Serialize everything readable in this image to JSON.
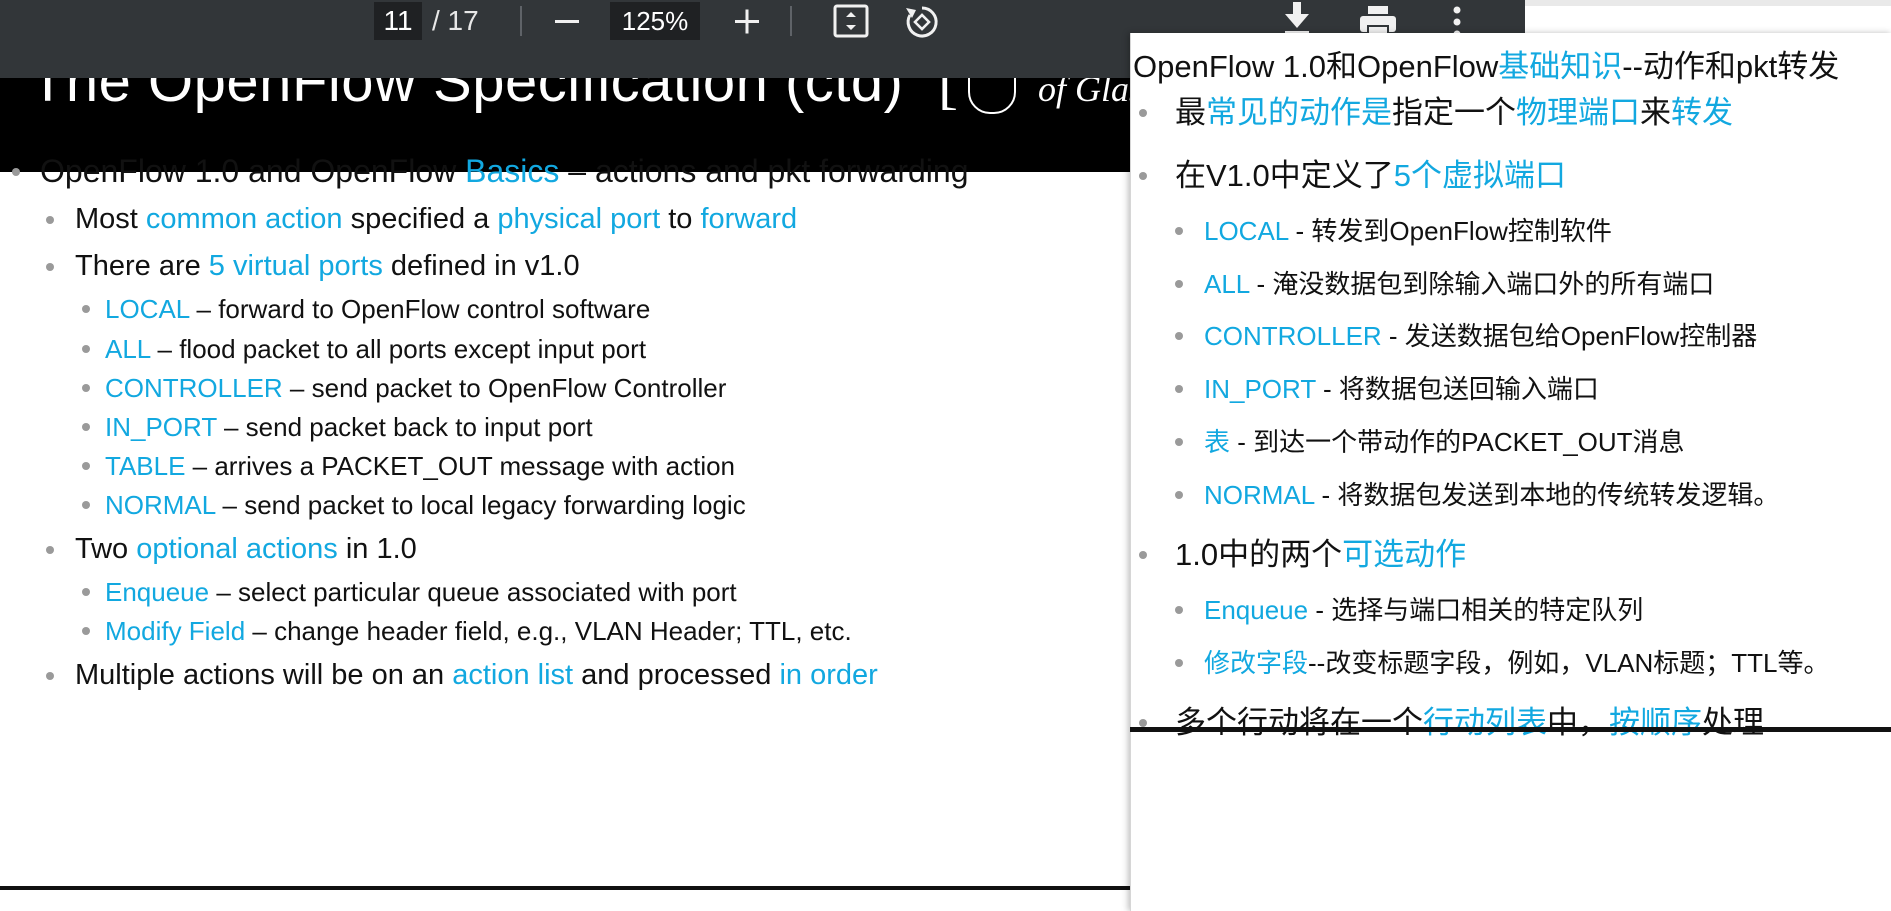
{
  "toolbar": {
    "page_current": "11",
    "page_total": "/ 17",
    "zoom_out_icon": "minus",
    "zoom": "125%",
    "zoom_in_icon": "plus",
    "icons": [
      "fit-page-icon",
      "rotate-icon",
      "download-icon",
      "print-icon",
      "more-icon"
    ]
  },
  "slide": {
    "title": "The OpenFlow Specification (ctd)",
    "logo_text": "of Glasgow",
    "bullets": [
      {
        "level": 1,
        "parts": [
          {
            "t": "OpenFlow 1.0 and OpenFlow "
          },
          {
            "t": "Basics",
            "hl": true
          },
          {
            "t": " – actions and pkt forwarding"
          }
        ]
      },
      {
        "level": 2,
        "parts": [
          {
            "t": "Most "
          },
          {
            "t": "common action",
            "hl": true
          },
          {
            "t": " specified a "
          },
          {
            "t": "physical port",
            "hl": true
          },
          {
            "t": " to "
          },
          {
            "t": "forward",
            "hl": true
          }
        ]
      },
      {
        "level": 2,
        "parts": [
          {
            "t": "There are "
          },
          {
            "t": "5 virtual ports",
            "hl": true
          },
          {
            "t": " defined in v1.0"
          }
        ]
      },
      {
        "level": 3,
        "parts": [
          {
            "t": "LOCAL",
            "hl": true
          },
          {
            "t": " – forward to OpenFlow control software"
          }
        ]
      },
      {
        "level": 3,
        "parts": [
          {
            "t": "ALL",
            "hl": true
          },
          {
            "t": " – flood packet to all ports except input port"
          }
        ]
      },
      {
        "level": 3,
        "parts": [
          {
            "t": "CONTROLLER",
            "hl": true
          },
          {
            "t": " – send packet to OpenFlow Controller"
          }
        ]
      },
      {
        "level": 3,
        "parts": [
          {
            "t": "IN_PORT",
            "hl": true
          },
          {
            "t": " – send packet back to input port"
          }
        ]
      },
      {
        "level": 3,
        "parts": [
          {
            "t": "TABLE",
            "hl": true
          },
          {
            "t": " – arrives a PACKET_OUT message with action"
          }
        ]
      },
      {
        "level": 3,
        "parts": [
          {
            "t": "NORMAL",
            "hl": true
          },
          {
            "t": " – send packet to local legacy forwarding logic"
          }
        ]
      },
      {
        "level": 2,
        "parts": [
          {
            "t": "Two "
          },
          {
            "t": "optional actions",
            "hl": true
          },
          {
            "t": " in 1.0"
          }
        ]
      },
      {
        "level": 3,
        "parts": [
          {
            "t": "Enqueue",
            "hl": true
          },
          {
            "t": " – select particular queue associated with port"
          }
        ]
      },
      {
        "level": 3,
        "parts": [
          {
            "t": "Modify Field",
            "hl": true
          },
          {
            "t": " – change header field, e.g., VLAN Header; TTL, etc."
          }
        ]
      },
      {
        "level": 2,
        "parts": [
          {
            "t": "Multiple actions will be on an "
          },
          {
            "t": "action list",
            "hl": true
          },
          {
            "t": " and processed "
          },
          {
            "t": "in order",
            "hl": true
          }
        ]
      }
    ]
  },
  "popup": {
    "title_parts": [
      {
        "t": "OpenFlow 1.0和OpenFlow"
      },
      {
        "t": "基础知识",
        "hl": true
      },
      {
        "t": "--动作和pkt转发"
      }
    ],
    "lines": [
      {
        "level": 1,
        "parts": [
          {
            "t": "最"
          },
          {
            "t": "常见的动作是",
            "hl": true
          },
          {
            "t": "指定一个"
          },
          {
            "t": "物理端口",
            "hl": true
          },
          {
            "t": "来"
          },
          {
            "t": "转发",
            "hl": true
          }
        ]
      },
      {
        "level": 1,
        "parts": [
          {
            "t": "在V1.0中定义了"
          },
          {
            "t": "5个虚拟端口",
            "hl": true
          }
        ]
      },
      {
        "level": 2,
        "parts": [
          {
            "t": "LOCAL",
            "hl": true
          },
          {
            "t": " - 转发到OpenFlow控制软件"
          }
        ]
      },
      {
        "level": 2,
        "parts": [
          {
            "t": "ALL",
            "hl": true
          },
          {
            "t": " - 淹没数据包到除输入端口外的所有端口"
          }
        ]
      },
      {
        "level": 2,
        "parts": [
          {
            "t": "CONTROLLER",
            "hl": true
          },
          {
            "t": " - 发送数据包给OpenFlow控制器"
          }
        ]
      },
      {
        "level": 2,
        "parts": [
          {
            "t": "IN_PORT",
            "hl": true
          },
          {
            "t": " - 将数据包送回输入端口"
          }
        ]
      },
      {
        "level": 2,
        "parts": [
          {
            "t": "表",
            "hl": true
          },
          {
            "t": " - 到达一个带动作的PACKET_OUT消息"
          }
        ]
      },
      {
        "level": 2,
        "parts": [
          {
            "t": "NORMAL",
            "hl": true
          },
          {
            "t": " - 将数据包发送到本地的传统转发逻辑。"
          }
        ]
      },
      {
        "level": 1,
        "parts": [
          {
            "t": "1.0中的两个"
          },
          {
            "t": "可选动作",
            "hl": true
          }
        ]
      },
      {
        "level": 2,
        "parts": [
          {
            "t": "Enqueue",
            "hl": true
          },
          {
            "t": " - 选择与端口相关的特定队列"
          }
        ]
      },
      {
        "level": 2,
        "parts": [
          {
            "t": "修改字段",
            "hl": true
          },
          {
            "t": "--改变标题字段，例如，VLAN标题；TTL等。"
          }
        ]
      },
      {
        "level": 1,
        "parts": [
          {
            "t": "多个行动将在一个"
          },
          {
            "t": "行动列表",
            "hl": true
          },
          {
            "t": "中，"
          },
          {
            "t": "按顺序",
            "hl": true
          },
          {
            "t": "处理"
          }
        ]
      }
    ]
  },
  "colors": {
    "highlight": "#12a8e0",
    "toolbar": "#323639",
    "bullet": "#9a9a9a"
  }
}
